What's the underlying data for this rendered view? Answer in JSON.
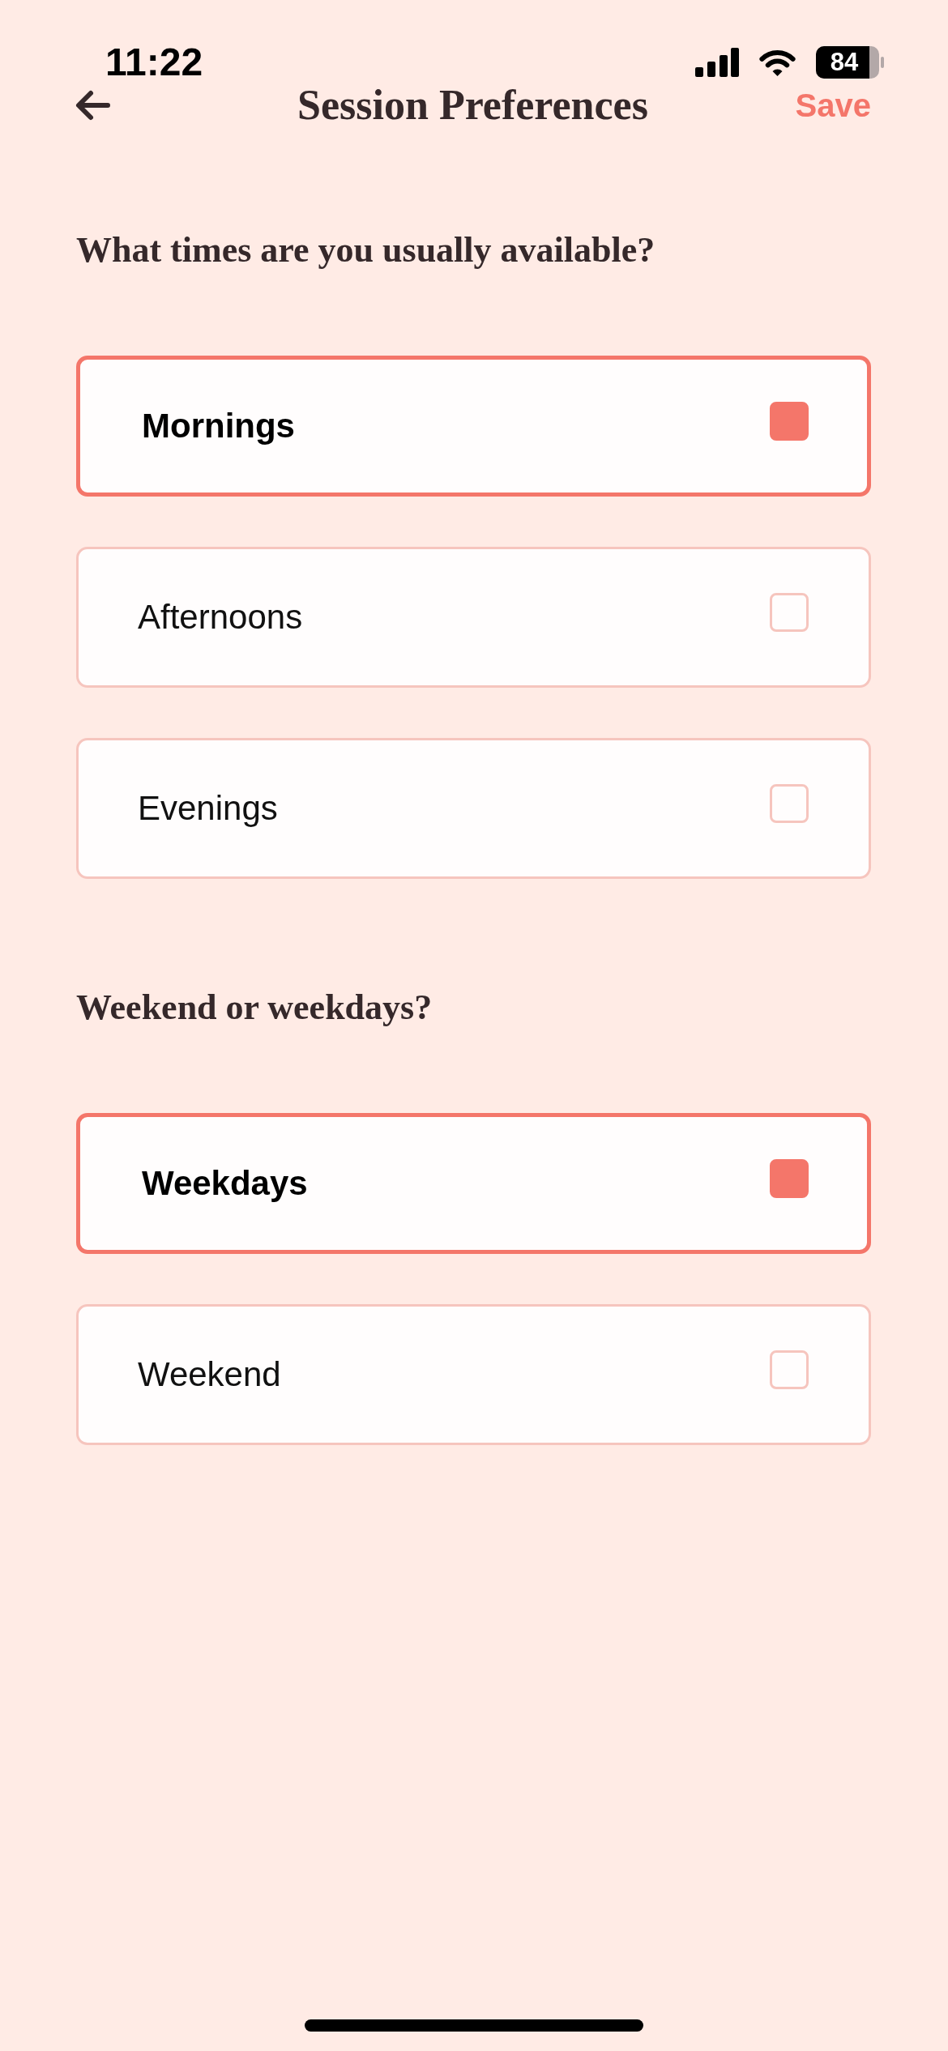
{
  "status_bar": {
    "time": "11:22",
    "battery": "84"
  },
  "header": {
    "title": "Session Preferences",
    "action": "Save"
  },
  "sections": [
    {
      "question": "What times are you usually available?",
      "options": [
        {
          "label": "Mornings",
          "selected": true
        },
        {
          "label": "Afternoons",
          "selected": false
        },
        {
          "label": "Evenings",
          "selected": false
        }
      ]
    },
    {
      "question": "Weekend or weekdays?",
      "options": [
        {
          "label": "Weekdays",
          "selected": true
        },
        {
          "label": "Weekend",
          "selected": false
        }
      ]
    }
  ]
}
